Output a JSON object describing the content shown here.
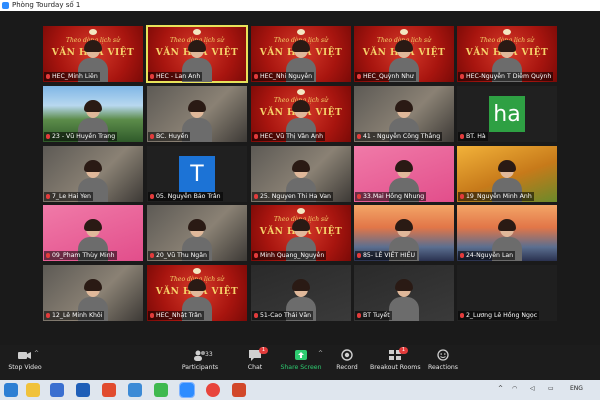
{
  "window": {
    "title": "Phòng Tourday số 1"
  },
  "tiles": [
    {
      "name": "HEC_Minh Liên",
      "type": "banner"
    },
    {
      "name": "HEC - Lan Anh",
      "type": "banner",
      "active": true
    },
    {
      "name": "HEC_Nhi Nguyễn",
      "type": "banner"
    },
    {
      "name": "HEC_Quỳnh Như",
      "type": "banner"
    },
    {
      "name": "HEC-Nguyễn T Diễm Quỳnh",
      "type": "banner"
    },
    {
      "name": "23 - Vũ Huyền Trang",
      "type": "landscape"
    },
    {
      "name": "BC. Huyền",
      "type": "room"
    },
    {
      "name": "HEC_Vũ Thị Vân Anh",
      "type": "banner"
    },
    {
      "name": "41 - Nguyễn Công Thắng",
      "type": "room"
    },
    {
      "name": "BT. Hà",
      "type": "avatar",
      "letter": "ha",
      "color": "#2ea043"
    },
    {
      "name": "7_Le Hai Yen",
      "type": "room"
    },
    {
      "name": "05. Nguyễn Bảo Trân",
      "type": "avatar",
      "letter": "T",
      "color": "#1c73d6"
    },
    {
      "name": "25. Nguyen Thi Ha Van",
      "type": "room"
    },
    {
      "name": "33.Mai Hồng Nhung",
      "type": "pink"
    },
    {
      "name": "19_Nguyễn Minh Anh",
      "type": "autumn"
    },
    {
      "name": "09_Pham Thùy Minh",
      "type": "pink"
    },
    {
      "name": "20_Vũ Thu Ngân",
      "type": "room"
    },
    {
      "name": "Minh Quang_Nguyễn",
      "type": "banner"
    },
    {
      "name": "85- LÊ VIẾT HIẾU",
      "type": "bridge"
    },
    {
      "name": "24-Nguyễn Lan",
      "type": "bridge"
    },
    {
      "name": "12_Lê Minh Khôi",
      "type": "room"
    },
    {
      "name": "HEC_Nhật Trân",
      "type": "banner"
    },
    {
      "name": "51-Cao Thái Văn",
      "type": "dark"
    },
    {
      "name": "BT Tuyết",
      "type": "dark"
    },
    {
      "name": "2_Lương Lê Hồng Ngọc",
      "type": "empty"
    }
  ],
  "banner_text": {
    "line1": "VĂN HÓA VIỆT",
    "line0": "Theo dòng lịch sử"
  },
  "toolbar": {
    "stop_video": "Stop Video",
    "participants": "Participants",
    "participants_count": "33",
    "chat": "Chat",
    "chat_badge": "1",
    "share_screen": "Share Screen",
    "record": "Record",
    "breakout_rooms": "Breakout Rooms",
    "breakout_badge": "1",
    "reactions": "Reactions"
  },
  "taskbar": {
    "lang": "ENG"
  }
}
